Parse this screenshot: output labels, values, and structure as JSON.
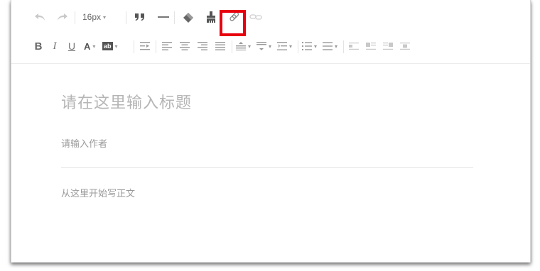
{
  "toolbar": {
    "undo_icon": "undo-icon",
    "redo_icon": "redo-icon",
    "font_size": "16px",
    "quote_label": "❞",
    "bold_label": "B",
    "italic_label": "I",
    "underline_label": "U",
    "font_color_label": "A",
    "bg_color_label": "ab"
  },
  "editor": {
    "title_placeholder": "请在这里输入标题",
    "author_placeholder": "请输入作者",
    "body_placeholder": "从这里开始写正文"
  },
  "colors": {
    "highlight": "#e8000f",
    "icon": "#999999",
    "placeholder": "#b5b5b5"
  }
}
